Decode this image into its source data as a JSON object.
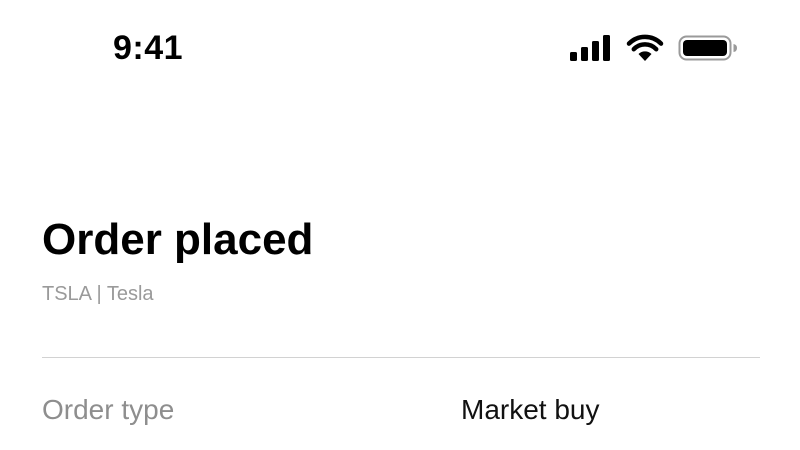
{
  "status_bar": {
    "time": "9:41",
    "icons": [
      "cellular-signal-icon",
      "wifi-icon",
      "battery-icon"
    ]
  },
  "order": {
    "title": "Order placed",
    "subtitle": "TSLA | Tesla",
    "details": [
      {
        "label": "Order type",
        "value": "Market buy"
      }
    ]
  },
  "colors": {
    "background": "#ffffff",
    "title_text": "#000000",
    "subtitle_text": "#9a9a9a",
    "label_text": "#8e8e8e",
    "divider": "#d2d2d2"
  }
}
